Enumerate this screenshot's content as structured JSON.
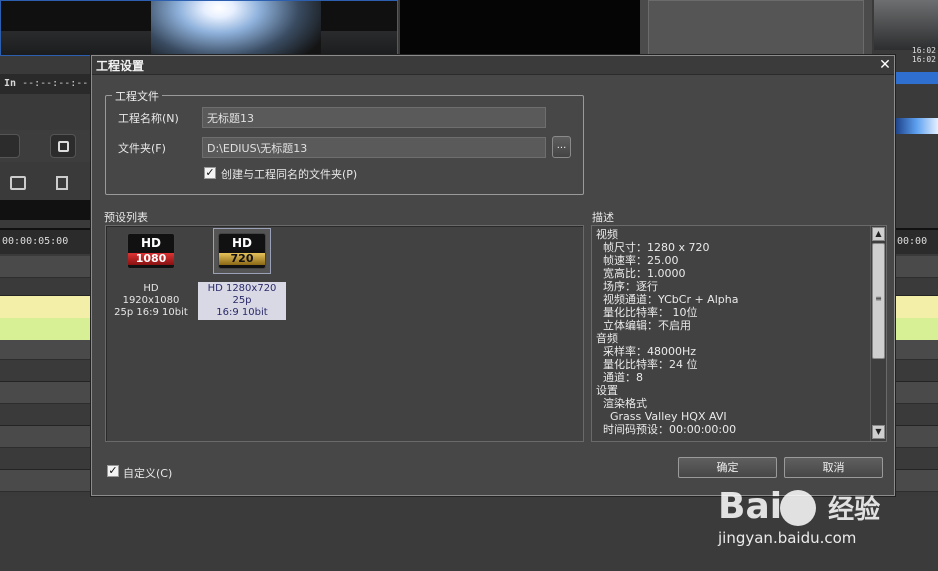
{
  "background": {
    "in_label": "In",
    "in_timecode": "--:--:--:--",
    "ruler_left": "00:00:05:00",
    "ruler_right": "00:00",
    "right_times": [
      "16:02",
      "16:02"
    ]
  },
  "dialog": {
    "title": "工程设置",
    "close_glyph": "✕",
    "project_group": {
      "legend": "工程文件",
      "name_label": "工程名称(N)",
      "name_value": "无标题13",
      "folder_label": "文件夹(F)",
      "folder_value": "D:\\EDIUS\\无标题13",
      "browse_label": "...",
      "create_folder_label": "创建与工程同名的文件夹(P)",
      "create_folder_checked": true
    },
    "presets": {
      "label": "预设列表",
      "items": [
        {
          "hd": "HD",
          "res": "1080",
          "caption_l1": "HD 1920x1080",
          "caption_l2": "25p 16:9 10bit",
          "selected": false,
          "icon": "hd1080-icon"
        },
        {
          "hd": "HD",
          "res": "720",
          "caption_l1": "HD 1280x720 25p",
          "caption_l2": "16:9 10bit",
          "selected": true,
          "icon": "hd720-icon"
        }
      ]
    },
    "description": {
      "label": "描述",
      "lines": [
        "视频",
        "  帧尺寸：1280 x 720",
        "  帧速率：25.00",
        "  宽高比：1.0000",
        "  场序：逐行",
        "  视频通道：YCbCr + Alpha",
        "  量化比特率： 10位",
        "  立体编辑：不启用",
        "音频",
        "  采样率：48000Hz",
        "  量化比特率：24 位",
        "  通道：8",
        "设置",
        "  渲染格式",
        "    Grass Valley HQX AVI",
        "  时间码预设：00:00:00:00"
      ]
    },
    "custom_label": "自定义(C)",
    "custom_checked": true,
    "ok_label": "确定",
    "cancel_label": "取消"
  },
  "watermark": {
    "logo_text": "Bai",
    "logo_text2": "经验",
    "url": "jingyan.baidu.com"
  },
  "colors": {
    "dialog_bg": "#474747",
    "track_yellow": "#f4efa8",
    "track_green": "#d7f096",
    "selection": "#d9d9e6"
  }
}
